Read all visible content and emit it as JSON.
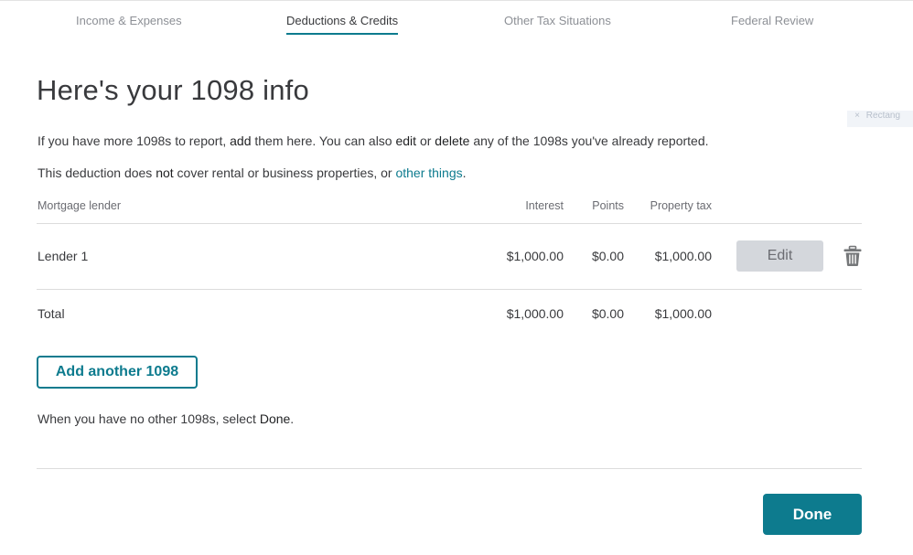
{
  "tabs": [
    {
      "label": "Income & Expenses",
      "active": false
    },
    {
      "label": "Deductions & Credits",
      "active": true
    },
    {
      "label": "Other Tax Situations",
      "active": false
    },
    {
      "label": "Federal Review",
      "active": false
    }
  ],
  "page": {
    "title": "Here's your 1098 info",
    "para1": {
      "t1": "If you have more 1098s to report, ",
      "add": "add",
      "t2": " them here. You can also ",
      "edit": "edit",
      "t3": " or ",
      "delete": "delete",
      "t4": " any of the 1098s you've already reported."
    },
    "para2": {
      "t1": "This deduction does ",
      "not": "not",
      "t2": " cover rental or business properties, or ",
      "link": "other things",
      "t3": "."
    },
    "para3": {
      "t1": "When you have no other 1098s, select ",
      "done": "Done",
      "t2": "."
    }
  },
  "table": {
    "headers": {
      "lender": "Mortgage lender",
      "interest": "Interest",
      "points": "Points",
      "property_tax": "Property tax"
    },
    "rows": [
      {
        "lender": "Lender 1",
        "interest": "$1,000.00",
        "points": "$0.00",
        "property_tax": "$1,000.00",
        "edit_label": "Edit",
        "delete_icon": "trash-icon"
      }
    ],
    "total": {
      "label": "Total",
      "interest": "$1,000.00",
      "points": "$0.00",
      "property_tax": "$1,000.00"
    }
  },
  "buttons": {
    "add_another": "Add another 1098",
    "done": "Done"
  },
  "overlay": {
    "chip_label": "Rectang"
  },
  "colors": {
    "accent": "#0d7b8e",
    "edit_bg": "#d4d7dc",
    "text": "#393a3d"
  }
}
